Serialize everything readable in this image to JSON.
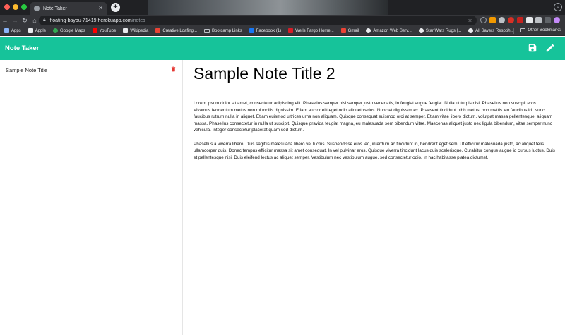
{
  "browser": {
    "tab_title": "Note Taker",
    "url_host": "floating-bayou-71419.herokuapp.com",
    "url_path": "/notes",
    "bookmarks": [
      {
        "label": "Apps",
        "icon": "apps-grid-icon",
        "color": "#8ab4f8"
      },
      {
        "label": "Apple",
        "icon": "apple-icon",
        "color": "#e8eaed"
      },
      {
        "label": "Google Maps",
        "icon": "google-maps-icon",
        "color": "#34a853"
      },
      {
        "label": "YouTube",
        "icon": "youtube-icon",
        "color": "#ff0000"
      },
      {
        "label": "Wikipedia",
        "icon": "wikipedia-icon",
        "color": "#e8eaed"
      },
      {
        "label": "Creative Loafing...",
        "icon": "gmail-icon",
        "color": "#ea4335"
      },
      {
        "label": "Bootcamp Links",
        "icon": "folder-icon",
        "color": "#bdc1c6"
      },
      {
        "label": "Facebook (1)",
        "icon": "facebook-icon",
        "color": "#1877f2"
      },
      {
        "label": "Wells Fargo Home...",
        "icon": "wells-fargo-icon",
        "color": "#d71e28"
      },
      {
        "label": "Gmail",
        "icon": "gmail-icon",
        "color": "#ea4335"
      },
      {
        "label": "Amazon Web Serv...",
        "icon": "globe-icon",
        "color": "#e8eaed"
      },
      {
        "label": "Star Wars Rugs |...",
        "icon": "globe-icon",
        "color": "#e8eaed"
      },
      {
        "label": "All Savers Respon...",
        "icon": "globe-icon",
        "color": "#e8eaed"
      }
    ],
    "more_bookmarks_label": "Other Bookmarks",
    "more_glyph": "»"
  },
  "app": {
    "title": "Note Taker",
    "accent": "#16c39a",
    "delete_color": "#e53935"
  },
  "notes": [
    {
      "title": "Sample Note Title"
    }
  ],
  "active_note": {
    "title": "Sample Note Title 2",
    "body": "Lorem ipsum dolor sit amet, consectetur adipiscing elit. Phasellus semper nisi semper justo venenatis, in feugiat augue feugiat. Nulla ut turpis nisl. Phasellus non suscipit eros. Vivamus fermentum metus non mi mollis dignissim. Etiam auctor elit eget odio aliquet varius. Nunc et dignissim ex. Praesent tincidunt nibh metus, non mattis leo faucibus id. Nunc faucibus rutrum nulla in aliquet. Etiam euismod ultrices urna non aliquam. Quisque consequat euismod orci at semper. Etiam vitae libero dictum, volutpat massa pellentesque, aliquam massa. Phasellus consectetur in nulla ut suscipit. Quisque gravida feugiat magna, eu malesuada sem bibendum vitae. Maecenas aliquet justo nec ligula bibendum, vitae semper nunc vehicula. Integer consectetur placerat quam sed dictum.\n\nPhasellus a viverra libero. Duis sagittis malesuada libero vel luctus. Suspendisse eros leo, interdum ac tincidunt in, hendrerit eget sem. Ut efficitur malesuada justo, ac aliquet felis ullamcorper quis. Donec tempus efficitur massa sit amet consequat. In vel pulvinar eros. Quisque viverra tincidunt lacus quis scelerisque. Curabitur congue augue id cursus luctus. Duis et pellentesque nisi. Duis eleifend lectus ac aliquet semper. Vestibulum nec vestibulum augue, sed consectetur odio. In hac habitasse platea dictumst."
  }
}
